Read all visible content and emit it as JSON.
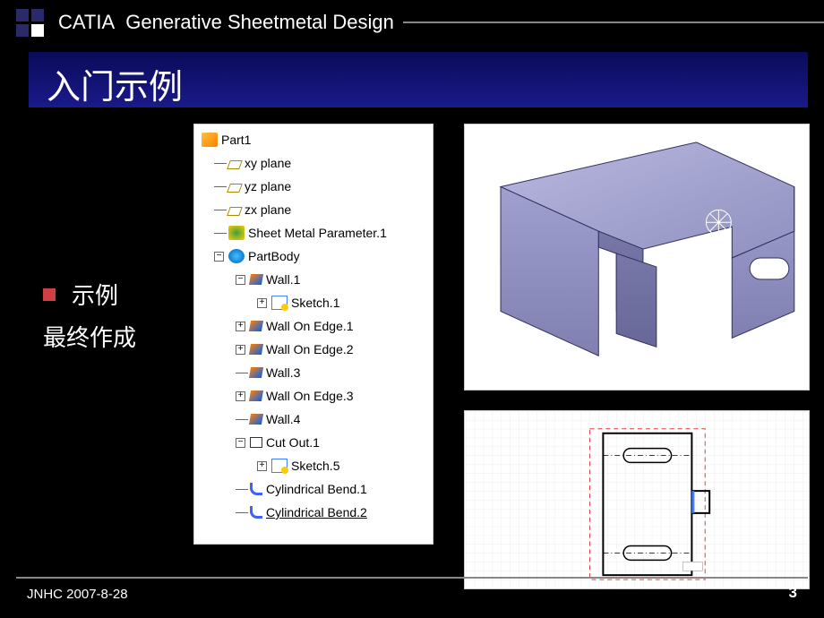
{
  "header": {
    "brand": "CATIA",
    "subtitle": "Generative Sheetmetal Design"
  },
  "title": "入门示例",
  "bullets": {
    "item1": "示例",
    "item2": "最终作成"
  },
  "tree": {
    "root": "Part1",
    "xy": "xy plane",
    "yz": "yz plane",
    "zx": "zx plane",
    "params": "Sheet Metal Parameter.1",
    "body": "PartBody",
    "wall1": "Wall.1",
    "sketch1": "Sketch.1",
    "woe1": "Wall On Edge.1",
    "woe2": "Wall On Edge.2",
    "wall3": "Wall.3",
    "woe3": "Wall On Edge.3",
    "wall4": "Wall.4",
    "cutout": "Cut Out.1",
    "sketch5": "Sketch.5",
    "bend1": "Cylindrical Bend.1",
    "bend2": "Cylindrical Bend.2"
  },
  "footer": {
    "left": "JNHC 2007-8-28",
    "page": "3"
  }
}
